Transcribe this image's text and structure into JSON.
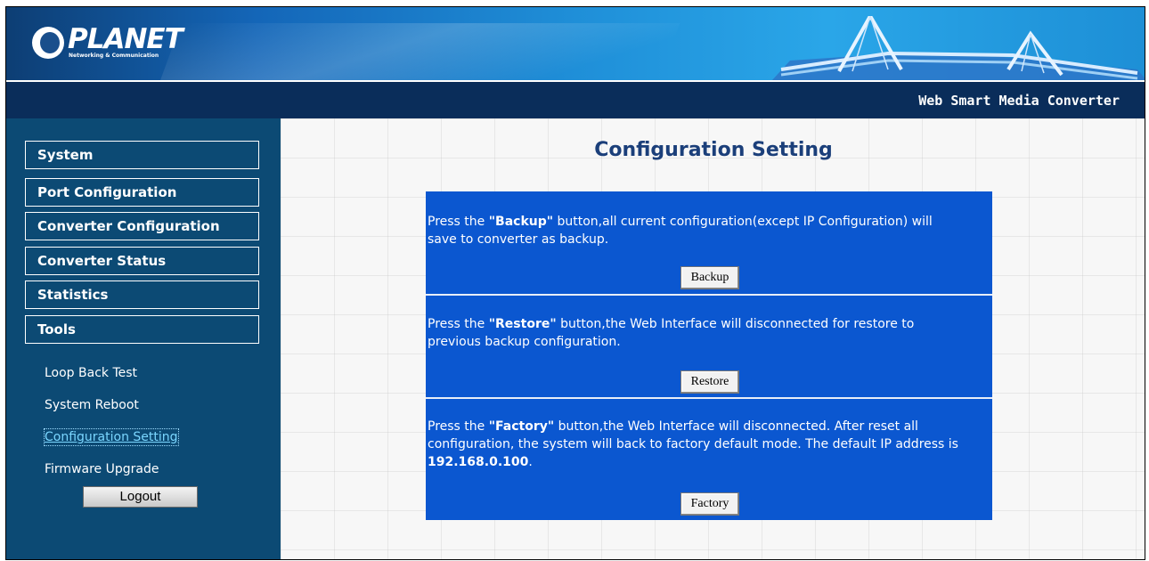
{
  "header": {
    "logo_brand": "PLANET",
    "logo_tagline": "Networking & Communication",
    "product_title": "Web Smart Media Converter"
  },
  "sidebar": {
    "menu": [
      {
        "label": "System"
      },
      {
        "label": "Port Configuration"
      },
      {
        "label": "Converter Configuration"
      },
      {
        "label": "Converter Status"
      },
      {
        "label": "Statistics"
      },
      {
        "label": "Tools"
      }
    ],
    "tools_submenu": [
      {
        "label": "Loop Back Test"
      },
      {
        "label": "System Reboot"
      },
      {
        "label": "Configuration Setting",
        "active": true
      },
      {
        "label": "Firmware Upgrade"
      }
    ],
    "logout_label": "Logout"
  },
  "main": {
    "title": "Configuration Setting",
    "panels": [
      {
        "prefix": "Press the ",
        "bold": "\"Backup\"",
        "suffix": " button,all current configuration(except IP Configuration) will save to converter as backup.",
        "button_label": "Backup"
      },
      {
        "prefix": "Press the ",
        "bold": "\"Restore\"",
        "suffix": " button,the Web Interface will disconnected for restore to previous backup configuration.",
        "button_label": "Restore"
      },
      {
        "prefix": "Press the ",
        "bold": "\"Factory\"",
        "suffix": " button,the Web Interface will disconnected. After reset all configuration, the system will back to factory default mode. The default IP address is ",
        "bold_ip": "192.168.0.100",
        "suffix2": ".",
        "button_label": "Factory"
      }
    ]
  },
  "colors": {
    "sidebar_bg": "#0c4a74",
    "title_bar_bg": "#0a2d5a",
    "panel_bg": "#0b57d0",
    "title_text": "#1b3f7a",
    "active_link": "#7ad6ff"
  }
}
